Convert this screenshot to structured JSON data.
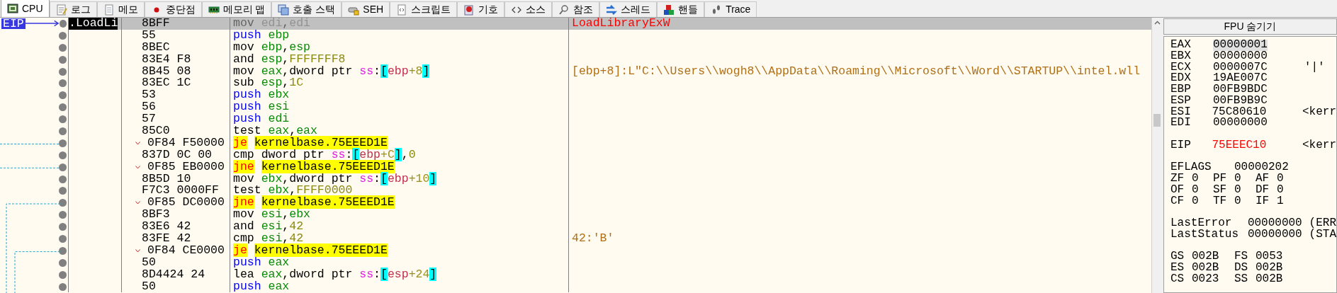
{
  "tabs": [
    {
      "label": "CPU",
      "selected": true
    },
    {
      "label": "로그",
      "selected": false
    },
    {
      "label": "메모",
      "selected": false
    },
    {
      "label": "중단점",
      "selected": false
    },
    {
      "label": "메모리 맵",
      "selected": false
    },
    {
      "label": "호출 스택",
      "selected": false
    },
    {
      "label": "SEH",
      "selected": false
    },
    {
      "label": "스크립트",
      "selected": false
    },
    {
      "label": "기호",
      "selected": false
    },
    {
      "label": "소스",
      "selected": false
    },
    {
      "label": "참조",
      "selected": false
    },
    {
      "label": "스레드",
      "selected": false
    },
    {
      "label": "핸들",
      "selected": false
    },
    {
      "label": "Trace",
      "selected": false
    }
  ],
  "eip_label": "EIP",
  "disassembly": [
    {
      "eip": true,
      "selected": true,
      "address": ".LoadLi",
      "bytes": "8BFF",
      "kind": "plain",
      "mnemonic": "mov",
      "operands": [
        {
          "text": "edi",
          "kind": "reg"
        },
        {
          "text": ",",
          "kind": "sep"
        },
        {
          "text": "edi",
          "kind": "reg"
        }
      ],
      "comment": {
        "text": "LoadLibraryExW",
        "kind": "api"
      }
    },
    {
      "eip": false,
      "selected": false,
      "bytes": "55",
      "kind": "stack",
      "mnemonic": "push",
      "operands": [
        {
          "text": "ebp",
          "kind": "reg"
        }
      ]
    },
    {
      "eip": false,
      "selected": false,
      "bytes": "8BEC",
      "kind": "plain",
      "mnemonic": "mov",
      "operands": [
        {
          "text": "ebp",
          "kind": "reg"
        },
        {
          "text": ",",
          "kind": "sep"
        },
        {
          "text": "esp",
          "kind": "reg"
        }
      ]
    },
    {
      "eip": false,
      "selected": false,
      "bytes": "83E4 F8",
      "kind": "plain",
      "mnemonic": "and",
      "operands": [
        {
          "text": "esp",
          "kind": "reg"
        },
        {
          "text": ",",
          "kind": "sep"
        },
        {
          "text": "FFFFFFF8",
          "kind": "num"
        }
      ]
    },
    {
      "eip": false,
      "selected": false,
      "bytes": "8B45 08",
      "kind": "plain",
      "mnemonic": "mov",
      "operands": [
        {
          "text": "eax",
          "kind": "reg"
        },
        {
          "text": ",",
          "kind": "sep"
        },
        {
          "text": "dword ptr ",
          "kind": "ptr"
        },
        {
          "text": "ss",
          "kind": "seg"
        },
        {
          "text": ":",
          "kind": "sep"
        },
        {
          "text": "[",
          "kind": "bracket"
        },
        {
          "text": "ebp",
          "kind": "memreg"
        },
        {
          "text": "+8",
          "kind": "memnum"
        },
        {
          "text": "]",
          "kind": "bracket"
        }
      ],
      "comment": {
        "text": "[ebp+8]:L\"C:\\\\Users\\\\wogh8\\\\AppData\\\\Roaming\\\\Microsoft\\\\Word\\\\STARTUP\\\\intel.wll",
        "kind": "string"
      }
    },
    {
      "eip": false,
      "selected": false,
      "bytes": "83EC 1C",
      "kind": "plain",
      "mnemonic": "sub",
      "operands": [
        {
          "text": "esp",
          "kind": "reg"
        },
        {
          "text": ",",
          "kind": "sep"
        },
        {
          "text": "1C",
          "kind": "num"
        }
      ]
    },
    {
      "eip": false,
      "selected": false,
      "bytes": "53",
      "kind": "stack",
      "mnemonic": "push",
      "operands": [
        {
          "text": "ebx",
          "kind": "reg"
        }
      ]
    },
    {
      "eip": false,
      "selected": false,
      "bytes": "56",
      "kind": "stack",
      "mnemonic": "push",
      "operands": [
        {
          "text": "esi",
          "kind": "reg"
        }
      ]
    },
    {
      "eip": false,
      "selected": false,
      "bytes": "57",
      "kind": "stack",
      "mnemonic": "push",
      "operands": [
        {
          "text": "edi",
          "kind": "reg"
        }
      ]
    },
    {
      "eip": false,
      "selected": false,
      "bytes": "85C0",
      "kind": "plain",
      "mnemonic": "test",
      "operands": [
        {
          "text": "eax",
          "kind": "reg"
        },
        {
          "text": ",",
          "kind": "sep"
        },
        {
          "text": "eax",
          "kind": "reg"
        }
      ]
    },
    {
      "eip": false,
      "selected": false,
      "bytes": "0F84 F50000",
      "kind": "jump",
      "mnemonic": "je",
      "operands": [
        {
          "text": "kernelbase.75EEED1E",
          "kind": "label"
        }
      ]
    },
    {
      "eip": false,
      "selected": false,
      "bytes": "837D 0C 00",
      "kind": "plain",
      "mnemonic": "cmp",
      "operands": [
        {
          "text": "dword ptr ",
          "kind": "ptr"
        },
        {
          "text": "ss",
          "kind": "seg"
        },
        {
          "text": ":",
          "kind": "sep"
        },
        {
          "text": "[",
          "kind": "bracket"
        },
        {
          "text": "ebp",
          "kind": "memreg"
        },
        {
          "text": "+C",
          "kind": "memnum"
        },
        {
          "text": "]",
          "kind": "bracket"
        },
        {
          "text": ",",
          "kind": "sep"
        },
        {
          "text": "0",
          "kind": "num"
        }
      ]
    },
    {
      "eip": false,
      "selected": false,
      "bytes": "0F85 EB0000",
      "kind": "jump",
      "mnemonic": "jne",
      "operands": [
        {
          "text": "kernelbase.75EEED1E",
          "kind": "label"
        }
      ]
    },
    {
      "eip": false,
      "selected": false,
      "bytes": "8B5D 10",
      "kind": "plain",
      "mnemonic": "mov",
      "operands": [
        {
          "text": "ebx",
          "kind": "reg"
        },
        {
          "text": ",",
          "kind": "sep"
        },
        {
          "text": "dword ptr ",
          "kind": "ptr"
        },
        {
          "text": "ss",
          "kind": "seg"
        },
        {
          "text": ":",
          "kind": "sep"
        },
        {
          "text": "[",
          "kind": "bracket"
        },
        {
          "text": "ebp",
          "kind": "memreg"
        },
        {
          "text": "+10",
          "kind": "memnum"
        },
        {
          "text": "]",
          "kind": "bracket"
        }
      ]
    },
    {
      "eip": false,
      "selected": false,
      "bytes": "F7C3 0000FF",
      "kind": "plain",
      "mnemonic": "test",
      "operands": [
        {
          "text": "ebx",
          "kind": "reg"
        },
        {
          "text": ",",
          "kind": "sep"
        },
        {
          "text": "FFFF0000",
          "kind": "num"
        }
      ]
    },
    {
      "eip": false,
      "selected": false,
      "bytes": "0F85 DC0000",
      "kind": "jump",
      "mnemonic": "jne",
      "operands": [
        {
          "text": "kernelbase.75EEED1E",
          "kind": "label"
        }
      ]
    },
    {
      "eip": false,
      "selected": false,
      "bytes": "8BF3",
      "kind": "plain",
      "mnemonic": "mov",
      "operands": [
        {
          "text": "esi",
          "kind": "reg"
        },
        {
          "text": ",",
          "kind": "sep"
        },
        {
          "text": "ebx",
          "kind": "reg"
        }
      ]
    },
    {
      "eip": false,
      "selected": false,
      "bytes": "83E6 42",
      "kind": "plain",
      "mnemonic": "and",
      "operands": [
        {
          "text": "esi",
          "kind": "reg"
        },
        {
          "text": ",",
          "kind": "sep"
        },
        {
          "text": "42",
          "kind": "num"
        }
      ]
    },
    {
      "eip": false,
      "selected": false,
      "bytes": "83FE 42",
      "kind": "plain",
      "mnemonic": "cmp",
      "operands": [
        {
          "text": "esi",
          "kind": "reg"
        },
        {
          "text": ",",
          "kind": "sep"
        },
        {
          "text": "42",
          "kind": "num"
        }
      ],
      "comment": {
        "text": "42:'B'",
        "kind": "string"
      }
    },
    {
      "eip": false,
      "selected": false,
      "bytes": "0F84 CE0000",
      "kind": "jump",
      "mnemonic": "je",
      "operands": [
        {
          "text": "kernelbase.75EEED1E",
          "kind": "label"
        }
      ]
    },
    {
      "eip": false,
      "selected": false,
      "bytes": "50",
      "kind": "stack",
      "mnemonic": "push",
      "operands": [
        {
          "text": "eax",
          "kind": "reg"
        }
      ]
    },
    {
      "eip": false,
      "selected": false,
      "bytes": "8D4424 24",
      "kind": "plain",
      "mnemonic": "lea",
      "operands": [
        {
          "text": "eax",
          "kind": "reg"
        },
        {
          "text": ",",
          "kind": "sep"
        },
        {
          "text": "dword ptr ",
          "kind": "ptr"
        },
        {
          "text": "ss",
          "kind": "seg"
        },
        {
          "text": ":",
          "kind": "sep"
        },
        {
          "text": "[",
          "kind": "bracket"
        },
        {
          "text": "esp",
          "kind": "memreg"
        },
        {
          "text": "+24",
          "kind": "memnum"
        },
        {
          "text": "]",
          "kind": "bracket"
        }
      ]
    },
    {
      "eip": false,
      "selected": false,
      "bytes": "50",
      "kind": "stack",
      "mnemonic": "push",
      "operands": [
        {
          "text": "eax",
          "kind": "reg"
        }
      ]
    }
  ],
  "register_panel": {
    "header_button": "FPU 숨기기",
    "general": [
      {
        "name": "EAX",
        "value": "00000001",
        "selected": true,
        "changed": false
      },
      {
        "name": "EBX",
        "value": "00000000",
        "selected": false,
        "changed": false
      },
      {
        "name": "ECX",
        "value": "0000007C",
        "comment": "'|'",
        "selected": false,
        "changed": false
      },
      {
        "name": "EDX",
        "value": "19AE007C",
        "selected": false,
        "changed": false
      },
      {
        "name": "EBP",
        "value": "00FB9BDC",
        "selected": false,
        "changed": false
      },
      {
        "name": "ESP",
        "value": "00FB9B9C",
        "selected": false,
        "changed": false
      },
      {
        "name": "ESI",
        "value": "75C80610",
        "comment": "<kerr",
        "selected": false,
        "changed": false
      },
      {
        "name": "EDI",
        "value": "00000000",
        "selected": false,
        "changed": false
      }
    ],
    "eip": {
      "name": "EIP",
      "value": "75EEEC10",
      "comment": "<kerr",
      "selected": false,
      "changed": true
    },
    "eflags": {
      "name": "EFLAGS",
      "value": "00000202"
    },
    "flags": [
      {
        "name": "ZF",
        "value": "0"
      },
      {
        "name": "PF",
        "value": "0"
      },
      {
        "name": "AF",
        "value": "0"
      },
      {
        "name": "OF",
        "value": "0"
      },
      {
        "name": "SF",
        "value": "0"
      },
      {
        "name": "DF",
        "value": "0"
      },
      {
        "name": "CF",
        "value": "0"
      },
      {
        "name": "TF",
        "value": "0"
      },
      {
        "name": "IF",
        "value": "1"
      }
    ],
    "last": [
      {
        "name": "LastError",
        "value": "00000000",
        "comment": "(ERR"
      },
      {
        "name": "LastStatus",
        "value": "00000000",
        "comment": "(STA"
      }
    ],
    "segments": [
      {
        "name": "GS",
        "value": "002B"
      },
      {
        "name": "FS",
        "value": "0053"
      },
      {
        "name": "ES",
        "value": "002B"
      },
      {
        "name": "DS",
        "value": "002B"
      },
      {
        "name": "CS",
        "value": "0023"
      },
      {
        "name": "SS",
        "value": "002B"
      }
    ]
  }
}
